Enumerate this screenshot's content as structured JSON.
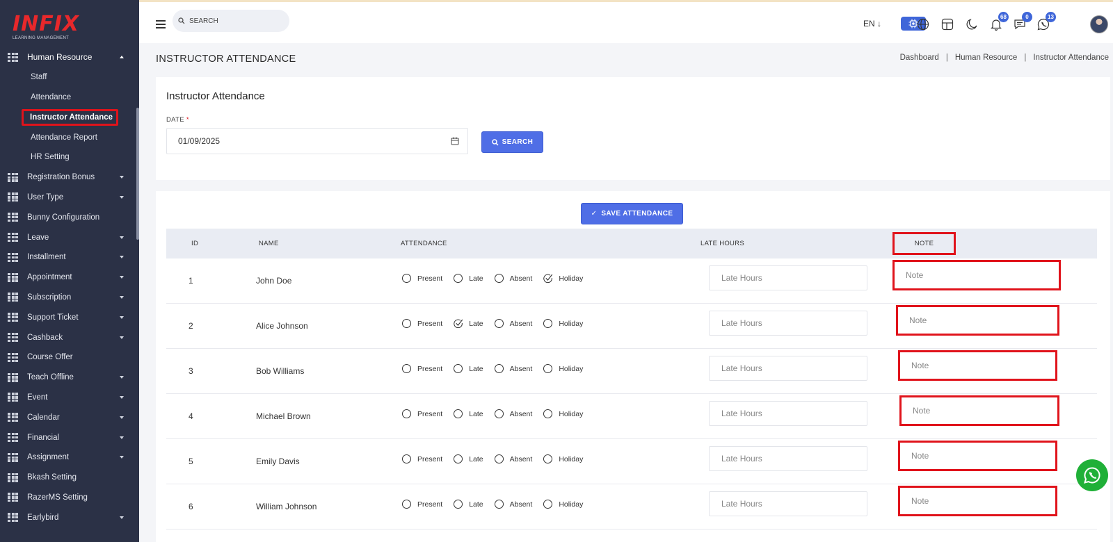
{
  "app": {
    "brand": "INFIX",
    "tagline": "LEARNING MANAGEMENT"
  },
  "sidebar": {
    "section": {
      "label": "Human Resource",
      "expanded": true
    },
    "sub_items": [
      {
        "label": "Staff",
        "active": false
      },
      {
        "label": "Attendance",
        "active": false
      },
      {
        "label": "Instructor Attendance",
        "active": true
      },
      {
        "label": "Attendance Report",
        "active": false
      },
      {
        "label": "HR Setting",
        "active": false
      }
    ],
    "items": [
      {
        "label": "Registration Bonus",
        "has_caret": true
      },
      {
        "label": "User Type",
        "has_caret": true
      },
      {
        "label": "Bunny Configuration",
        "has_caret": false
      },
      {
        "label": "Leave",
        "has_caret": true
      },
      {
        "label": "Installment",
        "has_caret": true
      },
      {
        "label": "Appointment",
        "has_caret": true
      },
      {
        "label": "Subscription",
        "has_caret": true
      },
      {
        "label": "Support Ticket",
        "has_caret": true
      },
      {
        "label": "Cashback",
        "has_caret": true
      },
      {
        "label": "Course Offer",
        "has_caret": false
      },
      {
        "label": "Teach Offline",
        "has_caret": true
      },
      {
        "label": "Event",
        "has_caret": true
      },
      {
        "label": "Calendar",
        "has_caret": true
      },
      {
        "label": "Financial",
        "has_caret": true
      },
      {
        "label": "Assignment",
        "has_caret": true
      },
      {
        "label": "Bkash Setting",
        "has_caret": false
      },
      {
        "label": "RazerMS Setting",
        "has_caret": false
      },
      {
        "label": "Earlybird",
        "has_caret": true
      }
    ]
  },
  "header": {
    "search_placeholder": "SEARCH",
    "language": "EN",
    "notifications_count": "68",
    "messages_count": "0",
    "whatsapp_count": "13"
  },
  "page": {
    "title": "INSTRUCTOR ATTENDANCE",
    "breadcrumb": [
      "Dashboard",
      "Human Resource",
      "Instructor Attendance"
    ]
  },
  "filter": {
    "card_title": "Instructor Attendance",
    "date_label": "DATE",
    "required_mark": "*",
    "date_value": "01/09/2025",
    "search_label": "SEARCH"
  },
  "table": {
    "save_label": "SAVE ATTENDANCE",
    "headers": {
      "id": "ID",
      "name": "NAME",
      "attendance": "ATTENDANCE",
      "late_hours": "LATE HOURS",
      "note": "NOTE"
    },
    "options": [
      "Present",
      "Late",
      "Absent",
      "Holiday"
    ],
    "late_placeholder": "Late Hours",
    "note_placeholder": "Note",
    "rows": [
      {
        "id": "1",
        "name": "John Doe",
        "selected": "Holiday"
      },
      {
        "id": "2",
        "name": "Alice Johnson",
        "selected": "Late"
      },
      {
        "id": "3",
        "name": "Bob Williams",
        "selected": ""
      },
      {
        "id": "4",
        "name": "Michael Brown",
        "selected": ""
      },
      {
        "id": "5",
        "name": "Emily Davis",
        "selected": ""
      },
      {
        "id": "6",
        "name": "William Johnson",
        "selected": ""
      }
    ]
  },
  "colors": {
    "sidebar_bg": "#2b3146",
    "accent": "#4f6ee6",
    "highlight": "#e0131b",
    "whatsapp": "#20b038"
  }
}
